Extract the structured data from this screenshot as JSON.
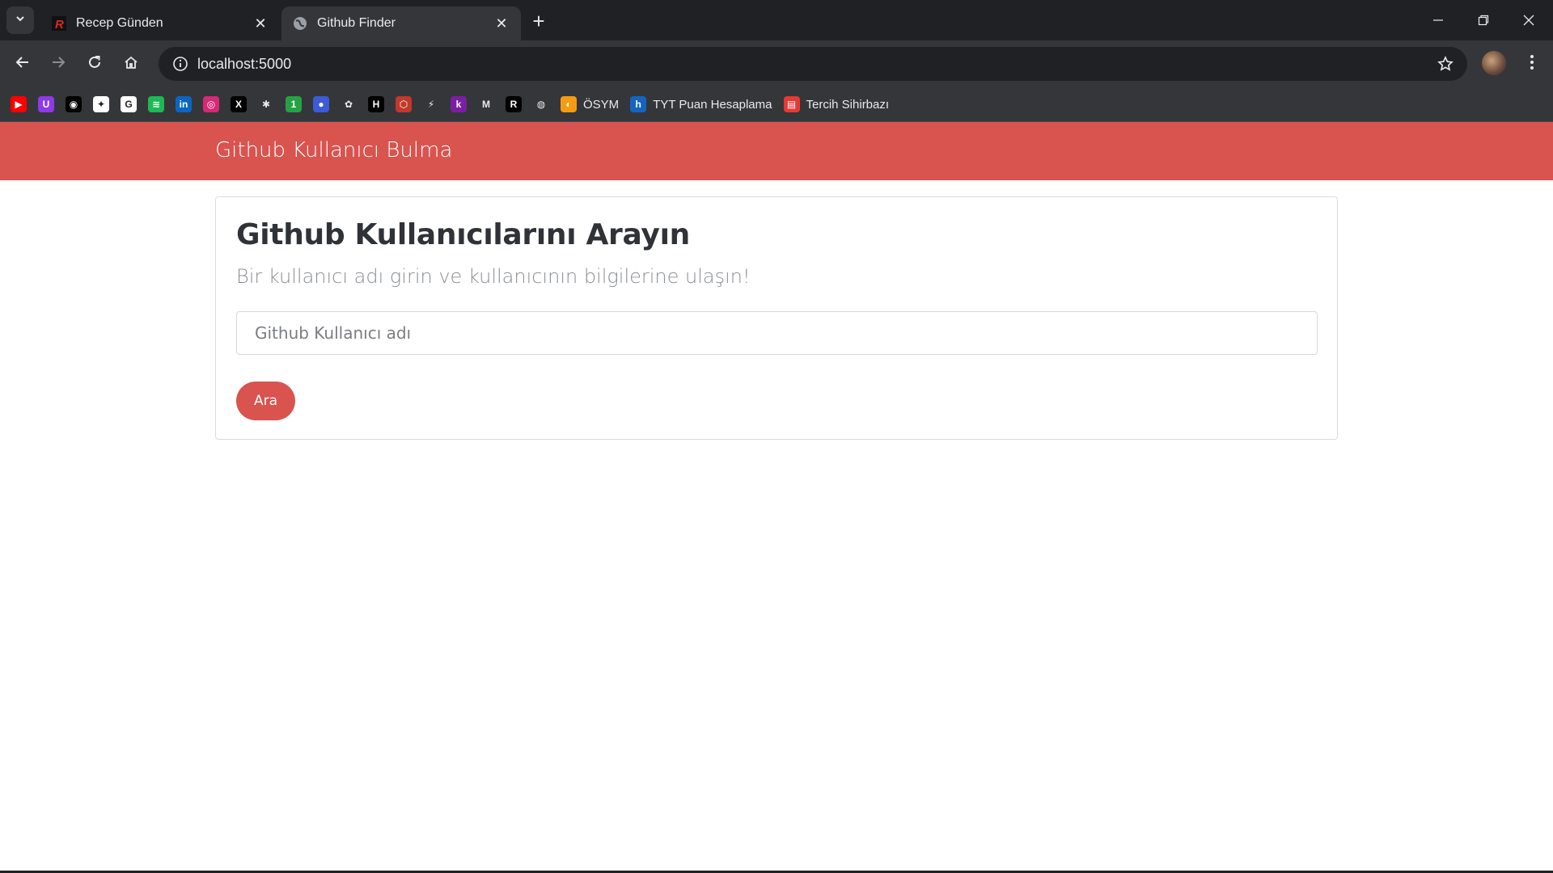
{
  "browser": {
    "tabs": [
      {
        "title": "Recep Günden",
        "favicon": "r-logo-icon",
        "active": false
      },
      {
        "title": "Github Finder",
        "favicon": "globe-icon",
        "active": true
      }
    ],
    "url": "localhost:5000",
    "bookmarks": [
      {
        "icon": "youtube-icon",
        "label": "",
        "color": "#ff0000",
        "glyph": "▶"
      },
      {
        "icon": "u-icon",
        "label": "",
        "color": "#8e3ae8",
        "glyph": "U"
      },
      {
        "icon": "github-icon",
        "label": "",
        "color": "#000000",
        "glyph": "◉"
      },
      {
        "icon": "chatgpt-icon",
        "label": "",
        "color": "#ffffff",
        "glyph": "✦"
      },
      {
        "icon": "google-icon",
        "label": "",
        "color": "#ffffff",
        "glyph": "G"
      },
      {
        "icon": "spotify-icon",
        "label": "",
        "color": "#1db954",
        "glyph": "≋"
      },
      {
        "icon": "linkedin-icon",
        "label": "",
        "color": "#0a66c2",
        "glyph": "in"
      },
      {
        "icon": "instagram-icon",
        "label": "",
        "color": "#d62976",
        "glyph": "◎"
      },
      {
        "icon": "x-icon",
        "label": "",
        "color": "#000000",
        "glyph": "X"
      },
      {
        "icon": "slack-icon",
        "label": "",
        "color": "#35363a",
        "glyph": "✱"
      },
      {
        "icon": "one-icon",
        "label": "",
        "color": "#25a244",
        "glyph": "1"
      },
      {
        "icon": "mega-icon",
        "label": "",
        "color": "#3c5bd8",
        "glyph": "●"
      },
      {
        "icon": "photos-icon",
        "label": "",
        "color": "#35363a",
        "glyph": "✿"
      },
      {
        "icon": "hackernews-icon",
        "label": "",
        "color": "#000000",
        "glyph": "H"
      },
      {
        "icon": "hex-icon",
        "label": "",
        "color": "#c0392b",
        "glyph": "⬡"
      },
      {
        "icon": "lightning-icon",
        "label": "",
        "color": "#35363a",
        "glyph": "⚡"
      },
      {
        "icon": "k-icon",
        "label": "",
        "color": "#7b1fa2",
        "glyph": "k"
      },
      {
        "icon": "gmail-icon",
        "label": "",
        "color": "#35363a",
        "glyph": "M"
      },
      {
        "icon": "r-logo-icon",
        "label": "",
        "color": "#000000",
        "glyph": "R"
      },
      {
        "icon": "globe-icon",
        "label": "",
        "color": "#35363a",
        "glyph": "◍"
      },
      {
        "icon": "osym-icon",
        "label": "ÖSYM",
        "color": "#f39c12",
        "glyph": "◐"
      },
      {
        "icon": "h-icon",
        "label": "TYT Puan Hesaplama",
        "color": "#1565c0",
        "glyph": "h"
      },
      {
        "icon": "tercih-icon",
        "label": "Tercih Sihirbazı",
        "color": "#e53935",
        "glyph": "▤"
      }
    ]
  },
  "app": {
    "brand": "Github Kullanıcı Bulma",
    "heading": "Github Kullanıcılarını Arayın",
    "lead": "Bir kullanıcı adı girin ve kullanıcının bilgilerine ulaşın!",
    "search_placeholder": "Github Kullanıcı adı",
    "search_value": "",
    "search_button": "Ara",
    "accent_color": "#d9534f"
  }
}
